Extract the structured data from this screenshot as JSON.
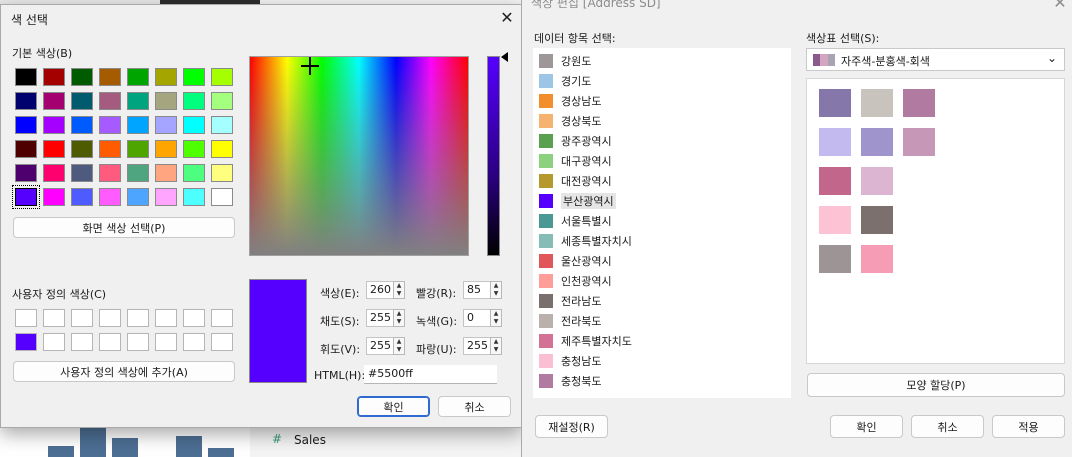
{
  "background": {
    "sales_label": "Sales"
  },
  "picker": {
    "title": "색 선택",
    "basic_label": "기본 색상(B)",
    "basic_colors": [
      [
        "#000000",
        "#a50000",
        "#005b00",
        "#a55b00",
        "#00a500",
        "#a5a500",
        "#00ff00",
        "#a5ff00"
      ],
      [
        "#00006f",
        "#a5006f",
        "#005b6f",
        "#a55b7f",
        "#00a57f",
        "#a5a57f",
        "#00ff7f",
        "#a5ff7f"
      ],
      [
        "#0000ff",
        "#a500ff",
        "#005bff",
        "#a55bff",
        "#00a5ff",
        "#a5a5ff",
        "#00ffff",
        "#a5ffff"
      ],
      [
        "#4e0000",
        "#ff0000",
        "#4e5b00",
        "#ff5b00",
        "#4ea500",
        "#ffa500",
        "#4eff00",
        "#ffff00"
      ],
      [
        "#4e006f",
        "#ff006f",
        "#4e5b7f",
        "#ff5b7f",
        "#4ea57f",
        "#ffa57f",
        "#4eff7f",
        "#ffff7f"
      ],
      [
        "#5500ff",
        "#ff00ff",
        "#4e5bff",
        "#ff5bff",
        "#4ea5ff",
        "#ffa5ff",
        "#4effff",
        "#ffffff"
      ]
    ],
    "pick_screen_button": "화면 색상 선택(P)",
    "custom_label": "사용자 정의 색상(C)",
    "custom_colors": [
      [
        "#ffffff",
        "#ffffff",
        "#ffffff",
        "#ffffff",
        "#ffffff",
        "#ffffff",
        "#ffffff",
        "#ffffff"
      ],
      [
        "#5500ff",
        "#ffffff",
        "#ffffff",
        "#ffffff",
        "#ffffff",
        "#ffffff",
        "#ffffff",
        "#ffffff"
      ]
    ],
    "add_custom_button": "사용자 정의 색상에 추가(A)",
    "preview_color": "#5500ff",
    "hue_label": "색상(E):",
    "hue_value": "260",
    "sat_label": "채도(S):",
    "sat_value": "255",
    "lum_label": "휘도(V):",
    "lum_value": "255",
    "red_label": "빨강(R):",
    "red_value": "85",
    "green_label": "녹색(G):",
    "green_value": "0",
    "blue_label": "파랑(U):",
    "blue_value": "255",
    "html_label": "HTML(H):",
    "html_value": "#5500ff",
    "ok_button": "확인",
    "cancel_button": "취소"
  },
  "edit": {
    "title": "색상 편집 [Address SD]",
    "items_label": "데이터 항목 선택:",
    "items": [
      {
        "label": "강원도",
        "color": "#9e9797"
      },
      {
        "label": "경기도",
        "color": "#9dc6e6"
      },
      {
        "label": "경상남도",
        "color": "#f28e2b"
      },
      {
        "label": "경상북도",
        "color": "#f5b36f"
      },
      {
        "label": "광주광역시",
        "color": "#59a14f"
      },
      {
        "label": "대구광역시",
        "color": "#8cd17d"
      },
      {
        "label": "대전광역시",
        "color": "#b6992d"
      },
      {
        "label": "부산광역시",
        "color": "#5500ff"
      },
      {
        "label": "서울특별시",
        "color": "#499894"
      },
      {
        "label": "세종특별자치시",
        "color": "#86bcb6"
      },
      {
        "label": "울산광역시",
        "color": "#e15759"
      },
      {
        "label": "인천광역시",
        "color": "#ff9d9a"
      },
      {
        "label": "전라남도",
        "color": "#79706e"
      },
      {
        "label": "전라북도",
        "color": "#bab0ac"
      },
      {
        "label": "제주특별자치도",
        "color": "#d37295"
      },
      {
        "label": "충청남도",
        "color": "#fabfd2"
      },
      {
        "label": "충청북도",
        "color": "#b07aa1"
      }
    ],
    "selected_index": 7,
    "palette_label": "색상표 선택(S):",
    "palette_selected": "자주색-분홍색-회색",
    "palette_preview_colors": [
      "#8b5a8c",
      "#d4a5c0",
      "#a9a3b3"
    ],
    "palette": [
      [
        "#8677aa",
        "#c8c3bd",
        "#b07aa1"
      ],
      [
        "#c3bbf0",
        "#9f94cb",
        "#c797b8"
      ],
      [
        "#c2678b",
        "#dcb5d2",
        ""
      ],
      [
        "#fdc2d4",
        "#7b706d",
        ""
      ],
      [
        "#9d9595",
        "#f69cb5",
        ""
      ]
    ],
    "assign_button": "모양 할당(P)",
    "reset_button": "재설정(R)",
    "ok_button": "확인",
    "cancel_button": "취소",
    "apply_button": "적용"
  }
}
